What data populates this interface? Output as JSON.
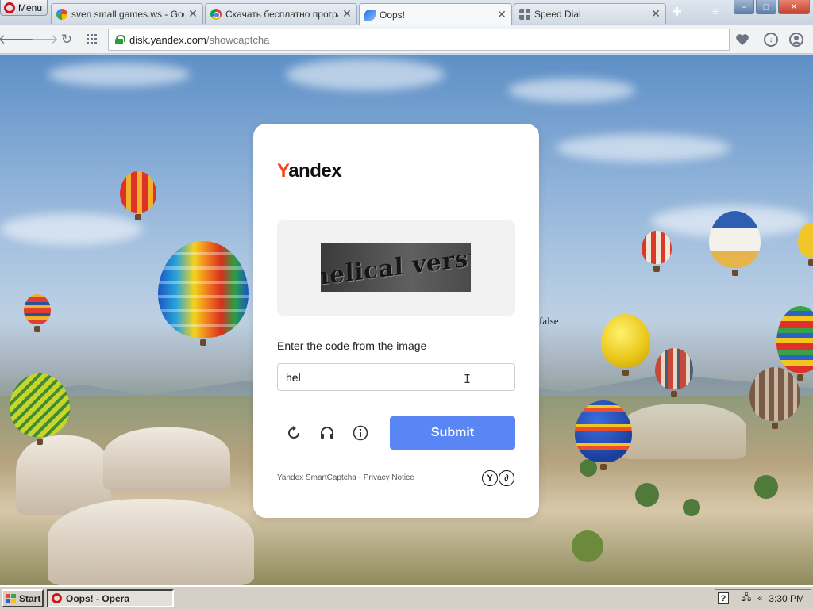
{
  "browser": {
    "menu_label": "Menu",
    "tabs": [
      {
        "title": "sven small games.ws - Google",
        "icon": "google-icon",
        "active": false
      },
      {
        "title": "Скачать бесплатно програм",
        "icon": "chrome-icon",
        "active": false
      },
      {
        "title": "Oops!",
        "icon": "yandex-disk-icon",
        "active": true
      },
      {
        "title": "Speed Dial",
        "icon": "speed-dial-icon",
        "active": false
      }
    ],
    "new_tab_symbol": "+",
    "tab_menu_symbol": "≡",
    "window_buttons": {
      "minimize": "–",
      "maximize": "□",
      "close": "✕"
    },
    "address": {
      "host": "disk.yandex.com",
      "path": "/showcaptcha"
    }
  },
  "page": {
    "stray_text": "false"
  },
  "captcha": {
    "logo": {
      "first_letter": "Y",
      "rest": "andex",
      "accent_color": "#fc3f1d"
    },
    "image_text": "helical verst",
    "prompt": "Enter the code from the image",
    "input_value": "hel",
    "submit_label": "Submit",
    "submit_color": "#5a86f5",
    "footer_text": "Yandex SmartCaptcha · Privacy Notice",
    "footer_logos": [
      "Y",
      "∂"
    ]
  },
  "taskbar": {
    "start_label": "Start",
    "task_label": "Oops! - Opera",
    "help_symbol": "?",
    "tray_arrows": "«",
    "clock": "3:30 PM"
  }
}
